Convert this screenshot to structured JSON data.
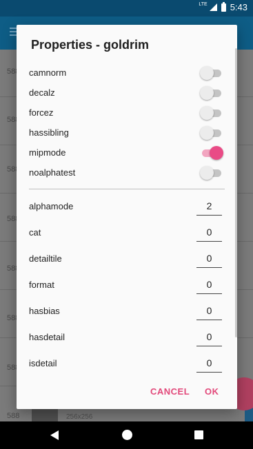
{
  "status_bar": {
    "network": "LTE",
    "time": "5:43"
  },
  "background": {
    "row_numbers": [
      "588",
      "588",
      "588",
      "588",
      "588",
      "588",
      "588",
      "588"
    ],
    "thumb_label": "256x256"
  },
  "dialog": {
    "title": "Properties - goldrim",
    "toggles": [
      {
        "label": "camnorm",
        "on": false
      },
      {
        "label": "decalz",
        "on": false
      },
      {
        "label": "forcez",
        "on": false
      },
      {
        "label": "hassibling",
        "on": false
      },
      {
        "label": "mipmode",
        "on": true
      },
      {
        "label": "noalphatest",
        "on": false
      }
    ],
    "numbers": [
      {
        "label": "alphamode",
        "value": "2"
      },
      {
        "label": "cat",
        "value": "0"
      },
      {
        "label": "detailtile",
        "value": "0"
      },
      {
        "label": "format",
        "value": "0"
      },
      {
        "label": "hasbias",
        "value": "0"
      },
      {
        "label": "hasdetail",
        "value": "0"
      },
      {
        "label": "isdetail",
        "value": "0"
      }
    ],
    "cancel_label": "CANCEL",
    "ok_label": "OK"
  },
  "colors": {
    "accent": "#e94b86",
    "toolbar": "#0e5d86"
  }
}
